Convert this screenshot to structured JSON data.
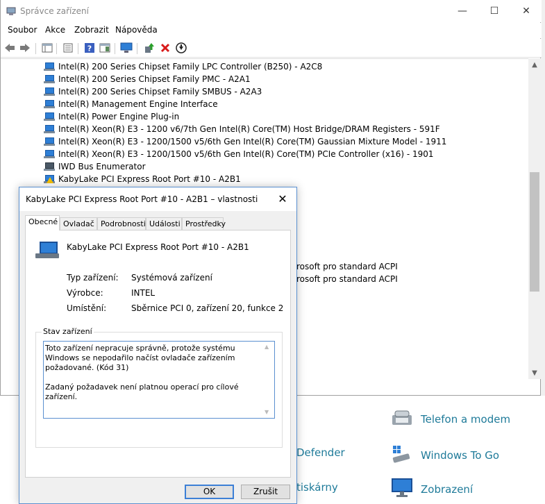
{
  "window": {
    "title": "Správce zařízení",
    "controls": [
      "—",
      "☐",
      "✕"
    ]
  },
  "menu": [
    "Soubor",
    "Akce",
    "Zobrazit",
    "Nápověda"
  ],
  "toolbar": {
    "icons": [
      "back-icon",
      "forward-icon",
      "properties-view-icon",
      "details-icon",
      "help-icon",
      "console-tree-icon",
      "monitor-icon",
      "update-driver-icon",
      "uninstall-icon",
      "download-icon"
    ]
  },
  "devices": [
    {
      "label": "Intel(R) 200 Series Chipset Family LPC Controller (B250) - A2C8",
      "warning": false
    },
    {
      "label": "Intel(R) 200 Series Chipset Family PMC - A2A1",
      "warning": false
    },
    {
      "label": "Intel(R) 200 Series Chipset Family SMBUS - A2A3",
      "warning": false
    },
    {
      "label": "Intel(R) Management Engine Interface",
      "warning": false
    },
    {
      "label": "Intel(R) Power Engine Plug-in",
      "warning": false
    },
    {
      "label": "Intel(R) Xeon(R) E3 - 1200 v6/7th Gen Intel(R) Core(TM) Host Bridge/DRAM Registers - 591F",
      "warning": false
    },
    {
      "label": "Intel(R) Xeon(R) E3 - 1200/1500 v5/6th Gen Intel(R) Core(TM) Gaussian Mixture Model - 1911",
      "warning": false
    },
    {
      "label": "Intel(R) Xeon(R) E3 - 1200/1500 v5/6th Gen Intel(R) Core(TM) PCIe Controller (x16) - 1901",
      "warning": false
    },
    {
      "label": "IWD Bus Enumerator",
      "warning": false
    },
    {
      "label": "KabyLake PCI Express Root Port #10 - A2B1",
      "warning": true
    }
  ],
  "hidden_rows_partial": [
    "rosoft pro standard ACPI",
    "rosoft pro standard ACPI"
  ],
  "dialog": {
    "title": "KabyLake PCI Express Root Port #10 - A2B1 – vlastnosti",
    "tabs": [
      "Obecné",
      "Ovladač",
      "Podrobnosti",
      "Události",
      "Prostředky"
    ],
    "device_name": "KabyLake PCI Express Root Port #10 - A2B1",
    "properties": [
      {
        "label": "Typ zařízení:",
        "value": "Systémová zařízení"
      },
      {
        "label": "Výrobce:",
        "value": "INTEL"
      },
      {
        "label": "Umístění:",
        "value": "Sběrnice PCI 0, zařízení 20, funkce 2"
      }
    ],
    "status_legend": "Stav zařízení",
    "status_line1": "Toto zařízení nepracuje správně, protože systému Windows se nepodařilo načíst ovladače zařízením požadované. (Kód 31)",
    "status_line2": "Zadaný požadavek není platnou operací pro cílové zařízení.",
    "ok_label": "OK",
    "cancel_label": "Zrušit"
  },
  "control_panel": {
    "items": [
      {
        "label": "Telefon a modem",
        "icon": "phone-modem-icon"
      },
      {
        "label": "Windows To Go",
        "icon": "usb-drive-icon"
      },
      {
        "label": "Zobrazení",
        "icon": "display-icon"
      }
    ],
    "partial_items": [
      "Defender",
      "tiskárny"
    ]
  },
  "colors": {
    "link": "#1e7a99",
    "accent": "#3c7fd6",
    "warning": "#f5c000"
  }
}
